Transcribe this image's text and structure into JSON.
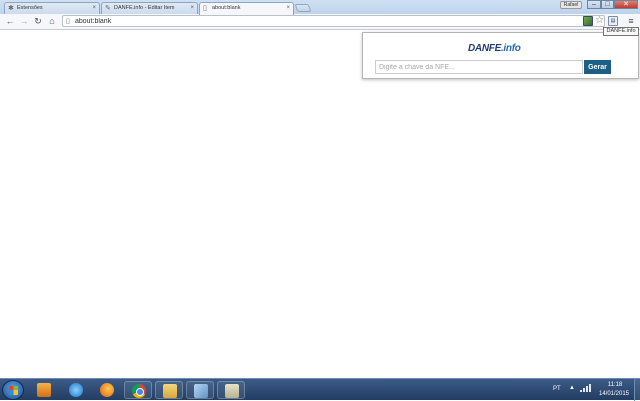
{
  "browser": {
    "tabs": [
      {
        "title": "Extensões",
        "icon": "puzzle-icon",
        "active": false
      },
      {
        "title": "DANFE.info - Editar Item",
        "icon": "edit-icon",
        "active": false
      },
      {
        "title": "about:blank",
        "icon": "page-icon",
        "active": true
      }
    ],
    "user_badge": "Rafael",
    "address": "about:blank",
    "tooltip": "DANFE.info"
  },
  "popup": {
    "logo_main": "DANFE",
    "logo_suffix": ".info",
    "input_placeholder": "Digite a chave da NFE...",
    "button_label": "Gerar",
    "accent": "#1b5e86"
  },
  "taskbar": {
    "apps": [
      "media-player-icon",
      "internet-explorer-icon",
      "firefox-icon",
      "chrome-icon",
      "file-explorer-icon",
      "window-icon",
      "app-icon"
    ],
    "language": "PT",
    "time": "11:18",
    "date": "14/01/2015"
  }
}
